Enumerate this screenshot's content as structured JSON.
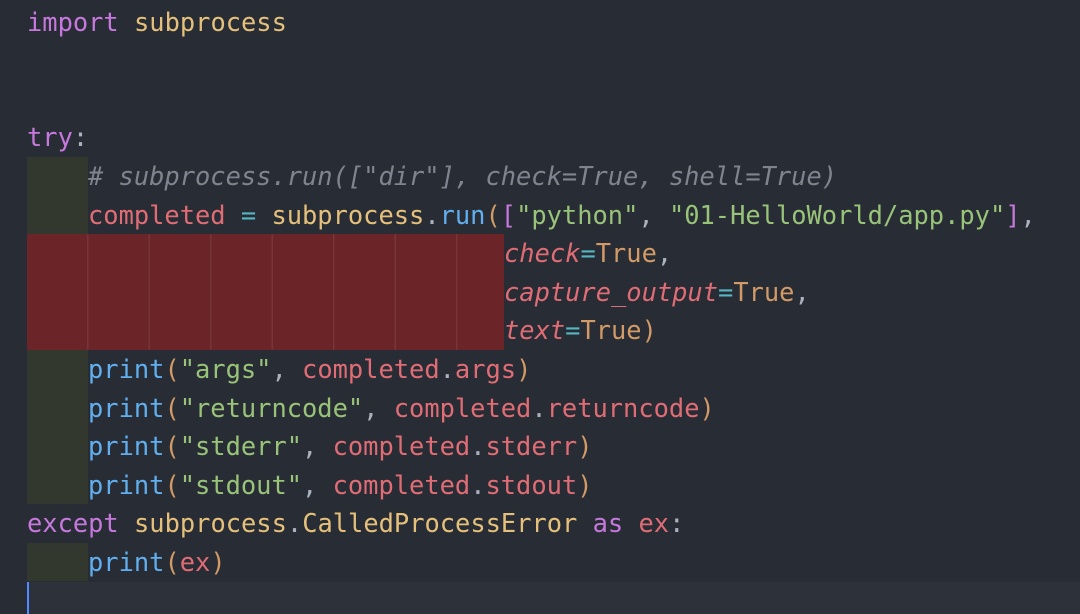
{
  "editor": {
    "language": "python",
    "theme_colors": {
      "background": "#282c34",
      "keyword": "#c678dd",
      "module": "#e5c07b",
      "variable": "#e06c75",
      "function": "#61afef",
      "string": "#98c379",
      "constant": "#d19a66",
      "comment": "#7f848e",
      "error_highlight": "#6b2427",
      "indent_guide": "#33382f",
      "cursor": "#528bff"
    },
    "lines": {
      "l1": {
        "kw": "import",
        "mod": "subprocess"
      },
      "l4": {
        "kw": "try",
        "colon": ":"
      },
      "l5": {
        "comment": "# subprocess.run([\"dir\"], check=True, shell=True)"
      },
      "l6": {
        "var": "completed",
        "eq": " = ",
        "mod": "subprocess",
        "dot": ".",
        "fn": "run",
        "open_paren": "(",
        "open_bracket": "[",
        "str1": "\"python\"",
        "comma1": ", ",
        "str2": "\"01-HelloWorld/app.py\"",
        "close_bracket": "]",
        "comma2": ","
      },
      "l7": {
        "param": "check",
        "eq": "=",
        "val": "True",
        "comma": ","
      },
      "l8": {
        "param": "capture_output",
        "eq": "=",
        "val": "True",
        "comma": ","
      },
      "l9": {
        "param": "text",
        "eq": "=",
        "val": "True",
        "close": ")"
      },
      "l10": {
        "fn": "print",
        "open": "(",
        "str": "\"args\"",
        "comma": ", ",
        "var": "completed",
        "dot": ".",
        "attr": "args",
        "close": ")"
      },
      "l11": {
        "fn": "print",
        "open": "(",
        "str": "\"returncode\"",
        "comma": ", ",
        "var": "completed",
        "dot": ".",
        "attr": "returncode",
        "close": ")"
      },
      "l12": {
        "fn": "print",
        "open": "(",
        "str": "\"stderr\"",
        "comma": ", ",
        "var": "completed",
        "dot": ".",
        "attr": "stderr",
        "close": ")"
      },
      "l13": {
        "fn": "print",
        "open": "(",
        "str": "\"stdout\"",
        "comma": ", ",
        "var": "completed",
        "dot": ".",
        "attr": "stdout",
        "close": ")"
      },
      "l14": {
        "kw": "except",
        "mod": "subprocess",
        "dot": ".",
        "cls": "CalledProcessError",
        "as": "as",
        "var": "ex",
        "colon": ":"
      },
      "l15": {
        "fn": "print",
        "open": "(",
        "var": "ex",
        "close": ")"
      }
    }
  }
}
